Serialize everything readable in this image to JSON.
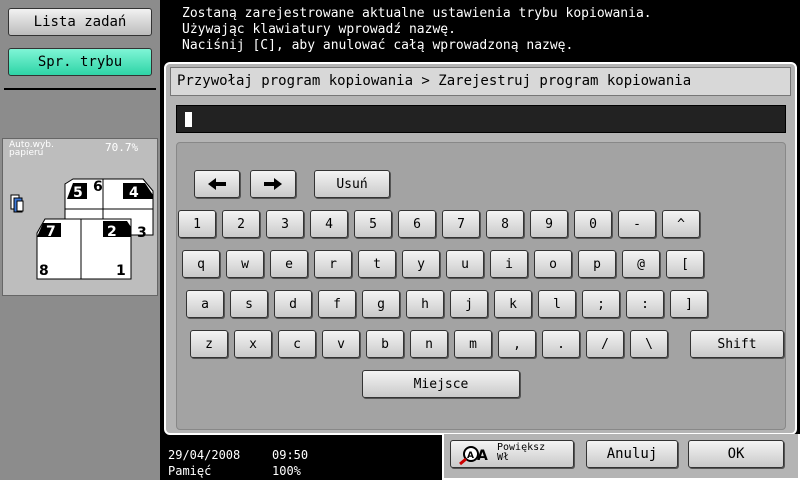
{
  "sidebar": {
    "job_list_label": "Lista zadań",
    "check_mode_label": "Spr. trybu",
    "auto_paper_line1": "Auto.wyb.",
    "auto_paper_line2": "papieru",
    "zoom": "70.7%",
    "layout_pages": [
      "5",
      "6",
      "4",
      "7",
      "2",
      "3",
      "8",
      "1"
    ]
  },
  "message": {
    "line1": "Zostaną zarejestrowane aktualne ustawienia trybu kopiowania.",
    "line2": "Używając klawiatury wprowadź nazwę.",
    "line3": "Naciśnij [C], aby anulować całą wprowadzoną nazwę."
  },
  "breadcrumb": "Przywołaj program kopiowania > Zarejestruj program kopiowania",
  "input": {
    "value": ""
  },
  "keyboard": {
    "delete_label": "Usuń",
    "row1": [
      "1",
      "2",
      "3",
      "4",
      "5",
      "6",
      "7",
      "8",
      "9",
      "0",
      "-",
      "^"
    ],
    "row2": [
      "q",
      "w",
      "e",
      "r",
      "t",
      "y",
      "u",
      "i",
      "o",
      "p",
      "@",
      "["
    ],
    "row3": [
      "a",
      "s",
      "d",
      "f",
      "g",
      "h",
      "j",
      "k",
      "l",
      ";",
      ":",
      "]"
    ],
    "row4": [
      "z",
      "x",
      "c",
      "v",
      "b",
      "n",
      "m",
      ",",
      ".",
      "/",
      "\\"
    ],
    "shift_label": "Shift",
    "space_label": "Miejsce"
  },
  "footer": {
    "date": "29/04/2008",
    "time": "09:50",
    "memory_label": "Pamięć",
    "memory_value": "100%"
  },
  "bottom": {
    "enlarge_line1": "Powiększ",
    "enlarge_line2": "Wł",
    "cancel_label": "Anuluj",
    "ok_label": "OK"
  }
}
